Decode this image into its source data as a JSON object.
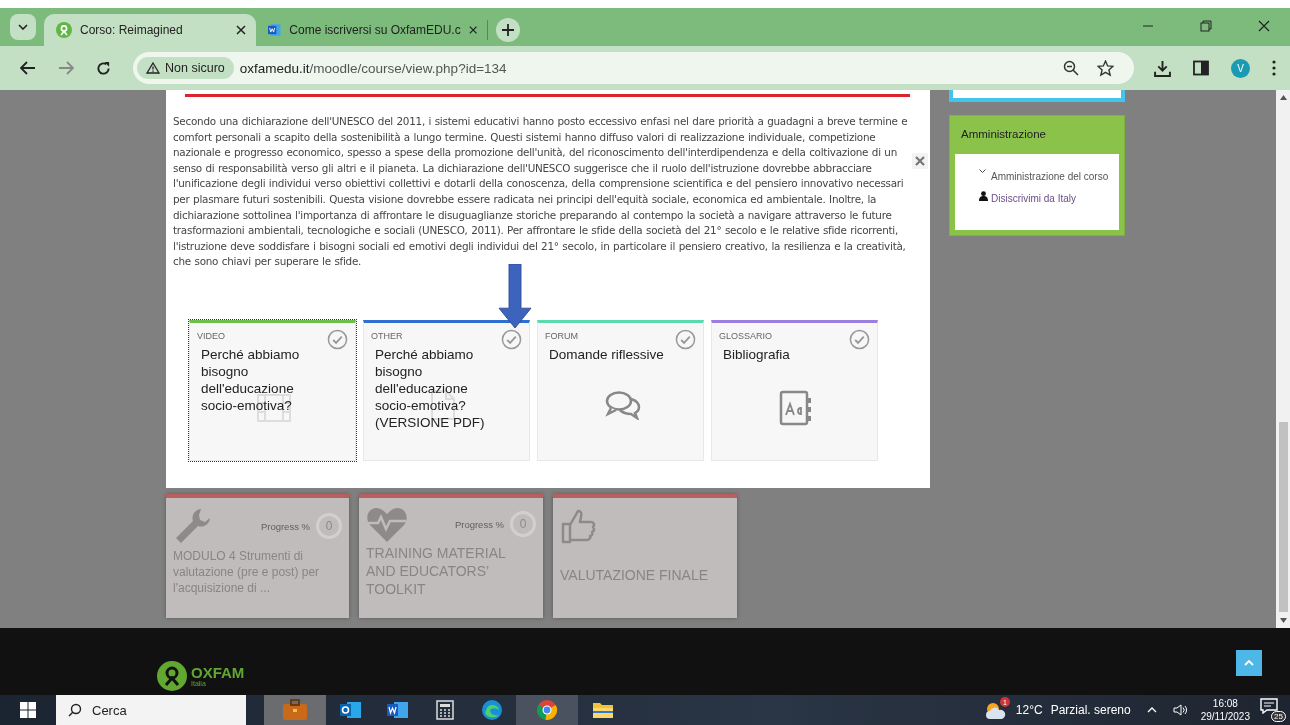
{
  "browser": {
    "tabs": [
      {
        "title": "Corso: Reimagined",
        "kind": "course",
        "selected": true
      },
      {
        "title": "Come iscriversi su OxfamEDU.c",
        "kind": "document",
        "selected": false
      }
    ],
    "security_label": "Non sicuro",
    "url_host": "oxfamedu.it",
    "url_path": "/moodle/course/view.php?id=134",
    "avatar_letter": "V"
  },
  "modal": {
    "paragraph": "Secondo una dichiarazione dell'UNESCO del 2011, i sistemi educativi hanno posto eccessivo enfasi nel dare priorità a guadagni a breve termine e comfort personali a scapito della sostenibilità a lungo termine. Questi sistemi hanno diffuso valori di realizzazione individuale, competizione nazionale e progresso economico, spesso a spese della promozione dell'unità, del riconoscimento dell'interdipendenza e della coltivazione di un senso di responsabilità verso gli altri e il pianeta. La dichiarazione dell'UNESCO suggerisce che il ruolo dell'istruzione dovrebbe abbracciare l'unificazione degli individui verso obiettivi collettivi e dotarli della conoscenza, della comprensione scientifica e del pensiero innovativo necessari per plasmare futuri sostenibili. Questa visione dovrebbe essere radicata nei principi dell'equità sociale, economica ed ambientale. Inoltre, la dichiarazione sottolinea l'importanza di affrontare le disuguaglianze storiche preparando al contempo la società a navigare attraverso le future trasformazioni ambientali, tecnologiche e sociali (UNESCO, 2011). Per affrontare le sfide della società del 21° secolo e le relative sfide ricorrenti, l'istruzione deve soddisfare i bisogni sociali ed emotivi degli individui del 21° secolo, in particolare il pensiero creativo, la resilienza e la creatività, che sono chiavi per superare le sfide.",
    "activities": [
      {
        "type": "VIDEO",
        "title": "Perché abbiamo bisogno dell'educazione socio-emotiva?",
        "color": "#6cc04a",
        "kind": "video",
        "focused": true
      },
      {
        "type": "OTHER",
        "title": "Perché abbiamo bisogno dell'educazione socio-emotiva? (VERSIONE PDF)",
        "color": "#2e6fd0",
        "kind": "file",
        "focused": false
      },
      {
        "type": "FORUM",
        "title": "Domande riflessive",
        "color": "#5ed8b0",
        "kind": "forum",
        "focused": false
      },
      {
        "type": "GLOSSARIO",
        "title": "Bibliografia",
        "color": "#9b7ee0",
        "kind": "glossary",
        "focused": false
      }
    ]
  },
  "course_tiles": [
    {
      "title": "MODULO 4 Strumenti di valutazione (pre e post) per l'acquisizione di ...",
      "kind": "wrench",
      "progress_label": "Progress %",
      "progress": "0"
    },
    {
      "title": "TRAINING MATERIAL AND EDUCATORS’ TOOLKIT",
      "kind": "heart",
      "progress_label": "Progress %",
      "progress": "0"
    },
    {
      "title": "VALUTAZIONE FINALE",
      "kind": "thumb"
    }
  ],
  "sidebar": {
    "block_title": "Amministrazione",
    "items": [
      {
        "label": "Amministrazione del corso",
        "kind": "branch"
      },
      {
        "label": "Disiscrivimi da Italy",
        "kind": "user"
      }
    ]
  },
  "footer": {
    "logo_text": "OXFAM",
    "logo_subtext": "Italia"
  },
  "taskbar": {
    "search_placeholder": "Cerca",
    "weather_temp": "12°C",
    "weather_text": "Parzial. sereno",
    "weather_badge": "1",
    "time": "16:08",
    "date": "29/11/2023",
    "notifications": "25"
  }
}
